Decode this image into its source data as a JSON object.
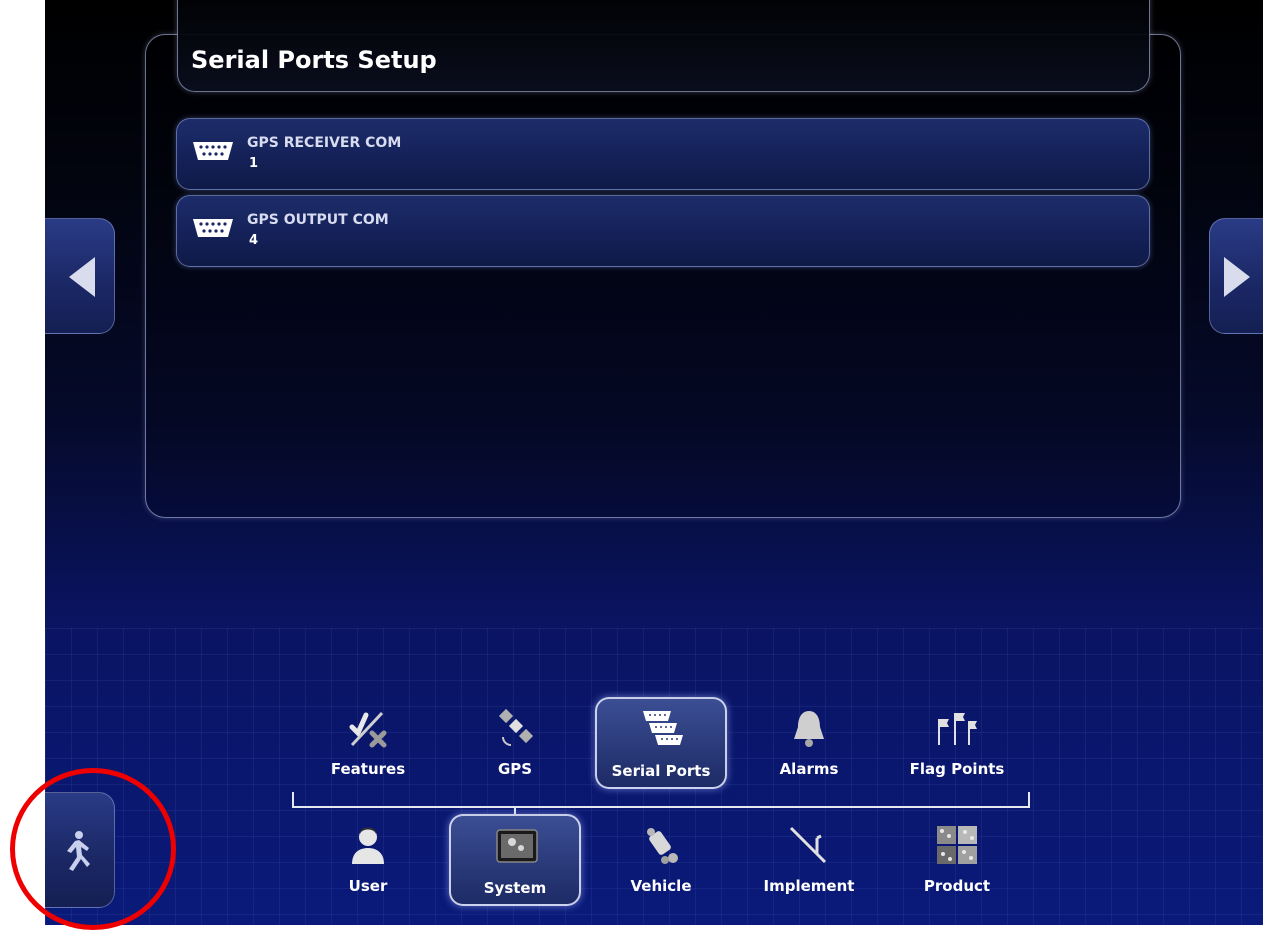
{
  "page": {
    "title": "Serial Ports Setup"
  },
  "ports": [
    {
      "label": "GPS RECEIVER COM",
      "value": "1",
      "icon": "serial-port-icon"
    },
    {
      "label": "GPS OUTPUT COM",
      "value": "4",
      "icon": "serial-port-icon"
    }
  ],
  "system_menu": [
    {
      "label": "Features",
      "icon": "features-icon",
      "selected": false
    },
    {
      "label": "GPS",
      "icon": "satellite-icon",
      "selected": false
    },
    {
      "label": "Serial Ports",
      "icon": "serial-ports-icon",
      "selected": true
    },
    {
      "label": "Alarms",
      "icon": "bell-icon",
      "selected": false
    },
    {
      "label": "Flag Points",
      "icon": "flags-icon",
      "selected": false
    }
  ],
  "main_menu": [
    {
      "label": "User",
      "icon": "user-icon",
      "selected": false
    },
    {
      "label": "System",
      "icon": "system-icon",
      "selected": true
    },
    {
      "label": "Vehicle",
      "icon": "vehicle-icon",
      "selected": false
    },
    {
      "label": "Implement",
      "icon": "implement-icon",
      "selected": false
    },
    {
      "label": "Product",
      "icon": "product-icon",
      "selected": false
    }
  ],
  "controls": {
    "prev_icon": "arrow-left-icon",
    "next_icon": "arrow-right-icon",
    "exit_icon": "running-man-icon"
  },
  "colors": {
    "accent_selected": "#2a3a7a",
    "highlight_annotation": "#ee0000"
  }
}
